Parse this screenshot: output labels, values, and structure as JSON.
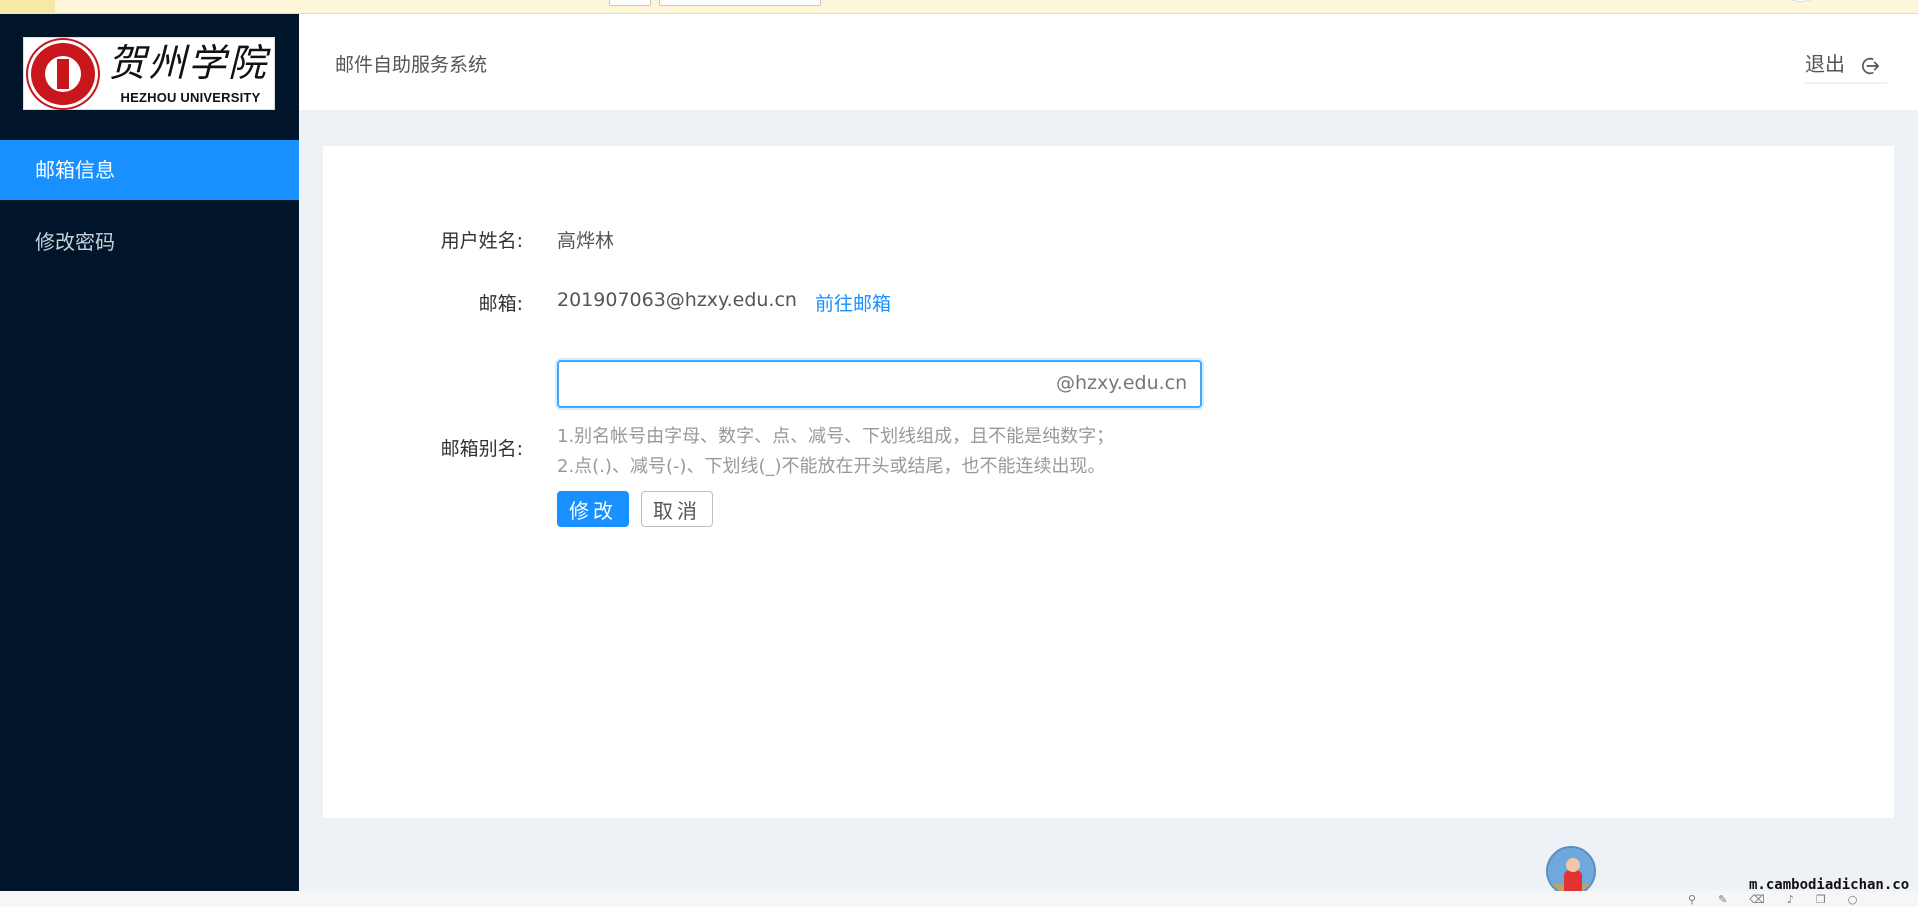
{
  "sidebar": {
    "logo": {
      "cn_text": "贺州学院",
      "en_text": "HEZHOU UNIVERSITY",
      "brand_color": "#c8161d"
    },
    "items": [
      {
        "label": "邮箱信息",
        "active": true
      },
      {
        "label": "修改密码",
        "active": false
      }
    ],
    "background": "#001529",
    "accent": "#1890ff"
  },
  "header": {
    "title": "邮件自助服务系统",
    "logout_label": "退出",
    "logout_icon": "logout-icon"
  },
  "form": {
    "username_label": "用户姓名:",
    "username_value": "高烨林",
    "email_label": "邮箱:",
    "email_value": "201907063@hzxy.edu.cn",
    "goto_mailbox_label": "前往邮箱",
    "alias_label": "邮箱别名:",
    "alias_value": "",
    "alias_suffix": "@hzxy.edu.cn",
    "hint_line1": "1.别名帐号由字母、数字、点、减号、下划线组成，且不能是纯数字；",
    "hint_line2": "2.点(.)、减号(-)、下划线(_)不能放在开头或结尾，也不能连续出现。",
    "submit_label": "修改",
    "cancel_label": "取消"
  },
  "footer": {
    "watermark": "m.cambodiadichan.co"
  }
}
